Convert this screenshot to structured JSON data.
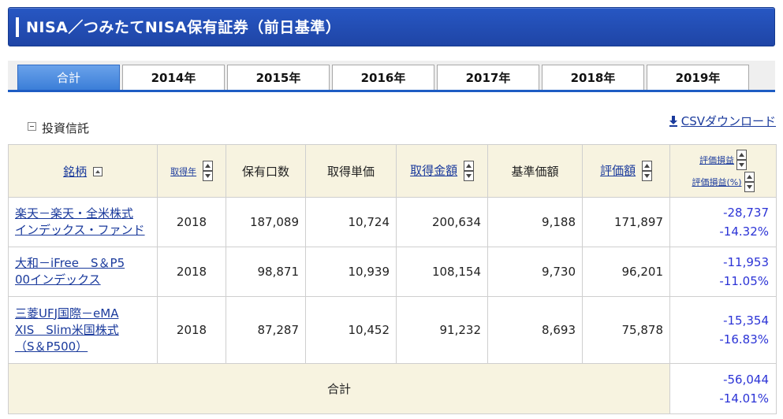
{
  "header": {
    "title": "NISA／つみたてNISA保有証券（前日基準）"
  },
  "tabs": [
    {
      "label": "合計",
      "active": true
    },
    {
      "label": "2014年",
      "active": false
    },
    {
      "label": "2015年",
      "active": false
    },
    {
      "label": "2016年",
      "active": false
    },
    {
      "label": "2017年",
      "active": false
    },
    {
      "label": "2018年",
      "active": false
    },
    {
      "label": "2019年",
      "active": false
    }
  ],
  "section": {
    "label": "投資信託",
    "csv_label": "CSVダウンロード"
  },
  "table": {
    "columns": {
      "name": "銘柄",
      "year": "取得年",
      "units": "保有口数",
      "unit_cost": "取得単価",
      "cost_amount": "取得金額",
      "nav": "基準価額",
      "valuation": "評価額",
      "pl": "評価損益",
      "pl_pct": "評価損益(%)"
    },
    "rows": [
      {
        "name_line1": "楽天－楽天・全米株式",
        "name_line2": "インデックス・ファンド",
        "name_line3": "",
        "year": "2018",
        "units": "187,089",
        "unit_cost": "10,724",
        "cost_amount": "200,634",
        "nav": "9,188",
        "valuation": "171,897",
        "pl": "-28,737",
        "pl_pct": "-14.32%"
      },
      {
        "name_line1": "大和－iFree　S＆P5",
        "name_line2": "00インデックス",
        "name_line3": "",
        "year": "2018",
        "units": "98,871",
        "unit_cost": "10,939",
        "cost_amount": "108,154",
        "nav": "9,730",
        "valuation": "96,201",
        "pl": "-11,953",
        "pl_pct": "-11.05%"
      },
      {
        "name_line1": "三菱UFJ国際－eMA",
        "name_line2": "XIS　Slim米国株式",
        "name_line3": "（S＆P500）",
        "year": "2018",
        "units": "87,287",
        "unit_cost": "10,452",
        "cost_amount": "91,232",
        "nav": "8,693",
        "valuation": "75,878",
        "pl": "-15,354",
        "pl_pct": "-16.83%"
      }
    ],
    "total": {
      "label": "合計",
      "pl": "-56,044",
      "pl_pct": "-14.01%"
    }
  },
  "colors": {
    "title_bg": "#2757c3",
    "tab_active": "#3b7ed8",
    "header_bg": "#f7f3e0",
    "link": "#1a3a9c",
    "negative": "#2b33d6"
  }
}
